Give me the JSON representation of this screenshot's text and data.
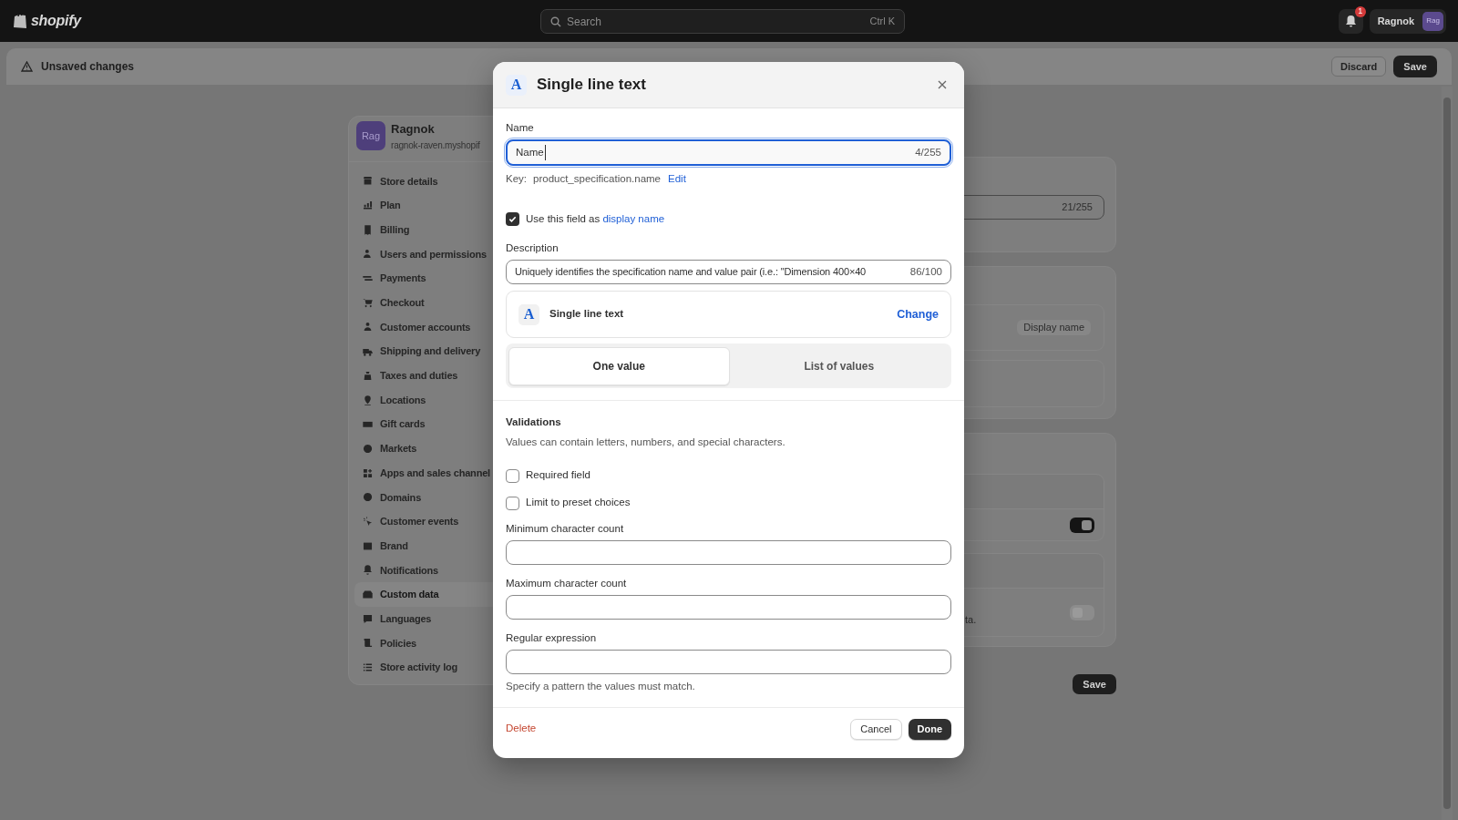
{
  "top_bar": {
    "logo_text": "shopify",
    "search": {
      "placeholder": "Search",
      "shortcut": "Ctrl K"
    },
    "notifications": {
      "badge": "1"
    },
    "account": {
      "name": "Ragnok",
      "avatar": "Rag"
    }
  },
  "unsaved_bar": {
    "message": "Unsaved changes",
    "buttons": [
      "Discard",
      "Save"
    ]
  },
  "sidebar": {
    "store": {
      "avatar": "Rag",
      "name": "Ragnok",
      "domain": "ragnok-raven.myshopif"
    },
    "items": [
      {
        "label": "Store details",
        "selected": false
      },
      {
        "label": "Plan",
        "selected": false
      },
      {
        "label": "Billing",
        "selected": false
      },
      {
        "label": "Users and permissions",
        "selected": false
      },
      {
        "label": "Payments",
        "selected": false
      },
      {
        "label": "Checkout",
        "selected": false
      },
      {
        "label": "Customer accounts",
        "selected": false
      },
      {
        "label": "Shipping and delivery",
        "selected": false
      },
      {
        "label": "Taxes and duties",
        "selected": false
      },
      {
        "label": "Locations",
        "selected": false
      },
      {
        "label": "Gift cards",
        "selected": false
      },
      {
        "label": "Markets",
        "selected": false
      },
      {
        "label": "Apps and sales channel",
        "selected": false
      },
      {
        "label": "Domains",
        "selected": false
      },
      {
        "label": "Customer events",
        "selected": false
      },
      {
        "label": "Brand",
        "selected": false
      },
      {
        "label": "Notifications",
        "selected": false
      },
      {
        "label": "Custom data",
        "selected": true
      },
      {
        "label": "Languages",
        "selected": false
      },
      {
        "label": "Policies",
        "selected": false
      },
      {
        "label": "Store activity log",
        "selected": false
      }
    ]
  },
  "background_cards": {
    "name_counter": "21/255",
    "badge": "Display name",
    "fragment": "ta.",
    "toggles": [
      {
        "on": true
      },
      {
        "on": false
      }
    ],
    "save_button": "Save"
  },
  "dialog": {
    "icon": "A",
    "title": "Single line text",
    "name": {
      "label": "Name",
      "value": "Name",
      "counter": "4/255"
    },
    "key": {
      "label": "Key:",
      "value": "product_specification.name",
      "link": "Edit"
    },
    "display_name": {
      "checked": true,
      "label": "Use this field as",
      "link": "display name"
    },
    "description": {
      "label": "Description",
      "value": "Uniquely identifies the specification name and value pair (i.e.: \"Dimension 400×40",
      "counter": "86/100"
    },
    "type": {
      "icon": "A",
      "name": "Single line text",
      "action": "Change"
    },
    "value_mode": [
      {
        "label": "One value",
        "selected": true
      },
      {
        "label": "List of values",
        "selected": false
      }
    ],
    "validations": {
      "title": "Validations",
      "hint": "Values can contain letters, numbers, and special characters.",
      "options": [
        {
          "label": "Required field",
          "checked": false
        },
        {
          "label": "Limit to preset choices",
          "checked": false
        }
      ],
      "fields": [
        {
          "label": "Minimum character count"
        },
        {
          "label": "Maximum character count"
        },
        {
          "label": "Regular expression",
          "help": "Specify a pattern the values must match."
        }
      ]
    },
    "footer": {
      "delete": "Delete",
      "cancel": "Cancel",
      "done": "Done"
    }
  }
}
